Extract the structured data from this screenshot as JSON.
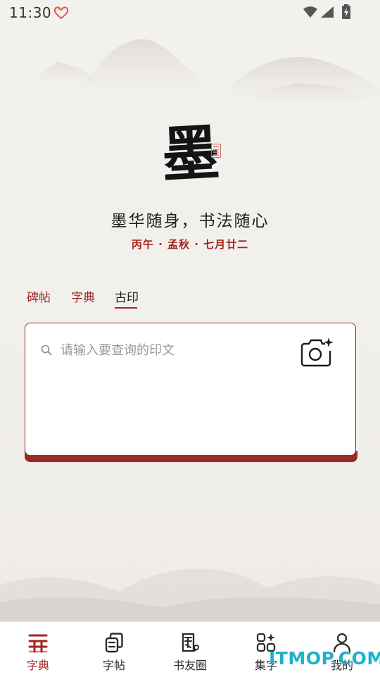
{
  "status_bar": {
    "time": "11:30"
  },
  "header": {
    "logo_char": "墨",
    "slogan": "墨华随身，书法随心",
    "lunar_date": "丙午 · 孟秋 · 七月廿二"
  },
  "tabs": [
    {
      "label": "碑帖"
    },
    {
      "label": "字典"
    },
    {
      "label": "古印"
    }
  ],
  "active_tab": "古印",
  "search": {
    "placeholder": "请输入要查询的印文",
    "value": ""
  },
  "bottom_nav": [
    {
      "label": "字典",
      "icon": "dictionary-icon",
      "active": true
    },
    {
      "label": "字帖",
      "icon": "copybook-icon",
      "active": false
    },
    {
      "label": "书友圈",
      "icon": "circle-icon",
      "active": false
    },
    {
      "label": "集字",
      "icon": "collect-icon",
      "active": false
    },
    {
      "label": "我的",
      "icon": "profile-icon",
      "active": false
    }
  ],
  "watermark": "ITMOP.COM",
  "colors": {
    "accent": "#a5241c",
    "card_border": "#9a2a22",
    "watermark": "#1fb1c9"
  }
}
